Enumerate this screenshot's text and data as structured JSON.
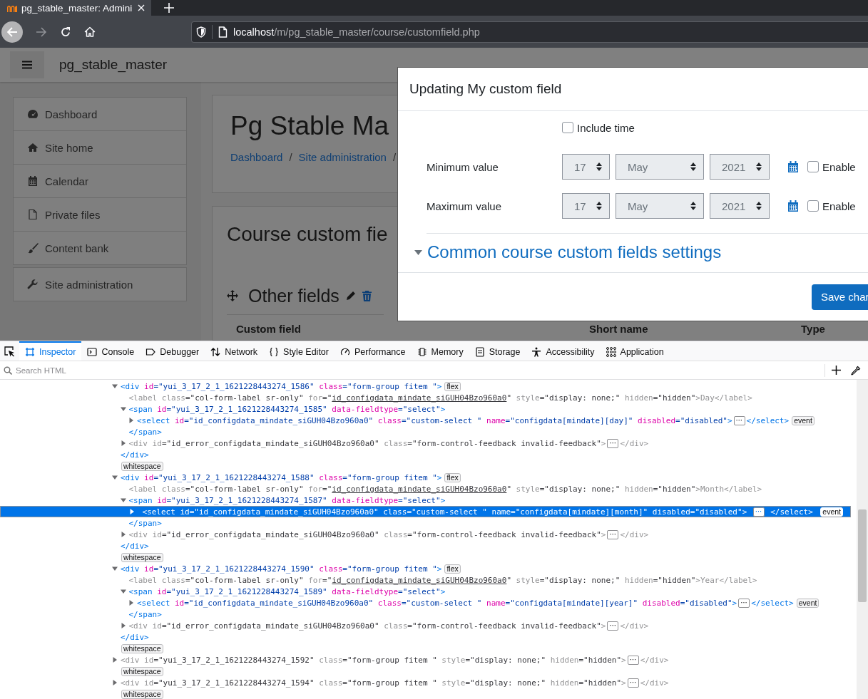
{
  "browser": {
    "tab": {
      "title": "pg_stable_master: Admini"
    },
    "url": {
      "host": "localhost",
      "path": "/m/pg_stable_master/course/customfield.php"
    }
  },
  "navbar": {
    "site_name": "pg_stable_master"
  },
  "sidebar": {
    "groups": [
      {
        "items": [
          {
            "label": "Dashboard"
          },
          {
            "label": "Site home"
          },
          {
            "label": "Calendar"
          },
          {
            "label": "Private files"
          },
          {
            "label": "Content bank"
          }
        ]
      },
      {
        "items": [
          {
            "label": "Site administration"
          }
        ]
      }
    ]
  },
  "header": {
    "title": "Pg Stable Ma",
    "breadcrumb": [
      {
        "label": "Dashboard",
        "separator": "/"
      },
      {
        "label": "Site administration",
        "separator": "/"
      }
    ]
  },
  "content": {
    "title": "Course custom fie",
    "category": "Other fields",
    "table": {
      "columns": [
        "Custom field",
        "Short name",
        "Type"
      ]
    }
  },
  "modal": {
    "title": "Updating My custom field",
    "include_time": {
      "label": "Include time",
      "checked": false
    },
    "rows": [
      {
        "label": "Minimum value",
        "day": "17",
        "month": "May",
        "year": "2021",
        "disabled": true,
        "enable": {
          "label": "Enable",
          "checked": false
        }
      },
      {
        "label": "Maximum value",
        "day": "17",
        "month": "May",
        "year": "2021",
        "disabled": true,
        "enable": {
          "label": "Enable",
          "checked": false
        }
      }
    ],
    "section": {
      "title": "Common course custom fields settings",
      "expanded": true
    },
    "save_button": "Save char"
  },
  "devtools": {
    "tabs": [
      {
        "label": "Inspector",
        "selected": true
      },
      {
        "label": "Console",
        "selected": false
      },
      {
        "label": "Debugger",
        "selected": false
      },
      {
        "label": "Network",
        "selected": false
      },
      {
        "label": "Style Editor",
        "selected": false
      },
      {
        "label": "Performance",
        "selected": false
      },
      {
        "label": "Memory",
        "selected": false
      },
      {
        "label": "Storage",
        "selected": false
      },
      {
        "label": "Accessibility",
        "selected": false
      },
      {
        "label": "Application",
        "selected": false
      }
    ],
    "search": {
      "placeholder": "Search HTML"
    },
    "tree": [
      {
        "kind": "element",
        "expanded": true,
        "dimmed": false,
        "selected": false,
        "badges": [
          "flex"
        ],
        "tag_open": [
          {
            "kind": "tag",
            "text": "<div"
          },
          {
            "kind": "attr",
            "text": " id"
          },
          {
            "kind": "value",
            "text": "=\"yui_3_17_2_1_1621228443274_1586\""
          },
          {
            "kind": "attr",
            "text": " class"
          },
          {
            "kind": "value",
            "text": "=\"form-group fitem \""
          },
          {
            "kind": "tag",
            "text": ">"
          }
        ],
        "tag_close": [
          {
            "kind": "tag",
            "text": "</div>"
          }
        ],
        "children": [
          {
            "kind": "element",
            "dimmed": true,
            "selected": false,
            "tag_open": [
              {
                "kind": "tag",
                "text": "<label"
              },
              {
                "kind": "attr",
                "text": " class"
              },
              {
                "kind": "value",
                "text": "=\"col-form-label sr-only\""
              },
              {
                "kind": "attr",
                "text": " for"
              },
              {
                "kind": "value",
                "text": "=\""
              },
              {
                "kind": "link",
                "text": "id_configdata_mindate_siGUH04Bzo960a0"
              },
              {
                "kind": "value",
                "text": "\""
              },
              {
                "kind": "attr",
                "text": " style"
              },
              {
                "kind": "value",
                "text": "=\"display: none;\""
              },
              {
                "kind": "attr",
                "text": " hidden"
              },
              {
                "kind": "value",
                "text": "=\"hidden\""
              },
              {
                "kind": "tag",
                "text": ">"
              },
              {
                "kind": "text",
                "text": "Day"
              },
              {
                "kind": "tag",
                "text": "</label>"
              }
            ]
          },
          {
            "kind": "element",
            "expanded": true,
            "dimmed": false,
            "selected": false,
            "tag_open": [
              {
                "kind": "tag",
                "text": "<span"
              },
              {
                "kind": "attr",
                "text": " id"
              },
              {
                "kind": "value",
                "text": "=\"yui_3_17_2_1_1621228443274_1585\""
              },
              {
                "kind": "attr",
                "text": " data-fieldtype"
              },
              {
                "kind": "value",
                "text": "=\"select\""
              },
              {
                "kind": "tag",
                "text": ">"
              }
            ],
            "tag_close": [
              {
                "kind": "tag",
                "text": "</span>"
              }
            ],
            "children": [
              {
                "kind": "element",
                "expanded": false,
                "dimmed": false,
                "selected": false,
                "inner": "⋯",
                "badges": [
                  "event"
                ],
                "tag_open": [
                  {
                    "kind": "tag",
                    "text": "<select"
                  },
                  {
                    "kind": "attr",
                    "text": " id"
                  },
                  {
                    "kind": "value",
                    "text": "=\"id_configdata_mindate_siGUH04Bzo960a0\""
                  },
                  {
                    "kind": "attr",
                    "text": " class"
                  },
                  {
                    "kind": "value",
                    "text": "=\"custom-select \""
                  },
                  {
                    "kind": "attr",
                    "text": " name"
                  },
                  {
                    "kind": "value",
                    "text": "=\"configdata[mindate][day]\""
                  },
                  {
                    "kind": "attr",
                    "text": " disabled"
                  },
                  {
                    "kind": "value",
                    "text": "=\"disabled\""
                  },
                  {
                    "kind": "tag",
                    "text": ">"
                  }
                ],
                "tag_close": [
                  {
                    "kind": "tag",
                    "text": "</select>"
                  }
                ]
              }
            ]
          },
          {
            "kind": "element",
            "expanded": false,
            "dimmed": true,
            "selected": false,
            "inner": "⋯",
            "tag_open": [
              {
                "kind": "tag",
                "text": "<div"
              },
              {
                "kind": "attr",
                "text": " id"
              },
              {
                "kind": "value",
                "text": "=\"id_error_configdata_mindate_siGUH04Bzo960a0\""
              },
              {
                "kind": "attr",
                "text": " class"
              },
              {
                "kind": "value",
                "text": "=\"form-control-feedback invalid-feedback\""
              },
              {
                "kind": "tag",
                "text": ">"
              }
            ],
            "tag_close": [
              {
                "kind": "tag",
                "text": "</div>"
              }
            ]
          }
        ]
      },
      {
        "kind": "whitespace",
        "label": "whitespace",
        "selected": false
      },
      {
        "kind": "element",
        "expanded": true,
        "dimmed": false,
        "selected": false,
        "badges": [
          "flex"
        ],
        "tag_open": [
          {
            "kind": "tag",
            "text": "<div"
          },
          {
            "kind": "attr",
            "text": " id"
          },
          {
            "kind": "value",
            "text": "=\"yui_3_17_2_1_1621228443274_1588\""
          },
          {
            "kind": "attr",
            "text": " class"
          },
          {
            "kind": "value",
            "text": "=\"form-group fitem \""
          },
          {
            "kind": "tag",
            "text": ">"
          }
        ],
        "tag_close": [
          {
            "kind": "tag",
            "text": "</div>"
          }
        ],
        "children": [
          {
            "kind": "element",
            "dimmed": true,
            "selected": false,
            "tag_open": [
              {
                "kind": "tag",
                "text": "<label"
              },
              {
                "kind": "attr",
                "text": " class"
              },
              {
                "kind": "value",
                "text": "=\"col-form-label sr-only\""
              },
              {
                "kind": "attr",
                "text": " for"
              },
              {
                "kind": "value",
                "text": "=\""
              },
              {
                "kind": "link",
                "text": "id_configdata_mindate_siGUH04Bzo960a0"
              },
              {
                "kind": "value",
                "text": "\""
              },
              {
                "kind": "attr",
                "text": " style"
              },
              {
                "kind": "value",
                "text": "=\"display: none;\""
              },
              {
                "kind": "attr",
                "text": " hidden"
              },
              {
                "kind": "value",
                "text": "=\"hidden\""
              },
              {
                "kind": "tag",
                "text": ">"
              },
              {
                "kind": "text",
                "text": "Month"
              },
              {
                "kind": "tag",
                "text": "</label>"
              }
            ]
          },
          {
            "kind": "element",
            "expanded": true,
            "dimmed": false,
            "selected": false,
            "tag_open": [
              {
                "kind": "tag",
                "text": "<span"
              },
              {
                "kind": "attr",
                "text": " id"
              },
              {
                "kind": "value",
                "text": "=\"yui_3_17_2_1_1621228443274_1587\""
              },
              {
                "kind": "attr",
                "text": " data-fieldtype"
              },
              {
                "kind": "value",
                "text": "=\"select\""
              },
              {
                "kind": "tag",
                "text": ">"
              }
            ],
            "tag_close": [
              {
                "kind": "tag",
                "text": "</span>"
              }
            ],
            "children": [
              {
                "kind": "element",
                "expanded": false,
                "dimmed": false,
                "selected": true,
                "inner": "⋯",
                "badges": [
                  "event"
                ],
                "tag_open": [
                  {
                    "kind": "tag",
                    "text": "<select"
                  },
                  {
                    "kind": "attr",
                    "text": " id"
                  },
                  {
                    "kind": "value",
                    "text": "=\"id_configdata_mindate_siGUH04Bzo960a0\""
                  },
                  {
                    "kind": "attr",
                    "text": " class"
                  },
                  {
                    "kind": "value",
                    "text": "=\"custom-select \""
                  },
                  {
                    "kind": "attr",
                    "text": " name"
                  },
                  {
                    "kind": "value",
                    "text": "=\"configdata[mindate][month]\""
                  },
                  {
                    "kind": "attr",
                    "text": " disabled"
                  },
                  {
                    "kind": "value",
                    "text": "=\"disabled\""
                  },
                  {
                    "kind": "tag",
                    "text": ">"
                  }
                ],
                "tag_close": [
                  {
                    "kind": "tag",
                    "text": "</select>"
                  }
                ]
              }
            ]
          },
          {
            "kind": "element",
            "expanded": false,
            "dimmed": true,
            "selected": false,
            "inner": "⋯",
            "tag_open": [
              {
                "kind": "tag",
                "text": "<div"
              },
              {
                "kind": "attr",
                "text": " id"
              },
              {
                "kind": "value",
                "text": "=\"id_error_configdata_mindate_siGUH04Bzo960a0\""
              },
              {
                "kind": "attr",
                "text": " class"
              },
              {
                "kind": "value",
                "text": "=\"form-control-feedback invalid-feedback\""
              },
              {
                "kind": "tag",
                "text": ">"
              }
            ],
            "tag_close": [
              {
                "kind": "tag",
                "text": "</div>"
              }
            ]
          }
        ]
      },
      {
        "kind": "whitespace",
        "label": "whitespace",
        "selected": false
      },
      {
        "kind": "element",
        "expanded": true,
        "dimmed": false,
        "selected": false,
        "badges": [
          "flex"
        ],
        "tag_open": [
          {
            "kind": "tag",
            "text": "<div"
          },
          {
            "kind": "attr",
            "text": " id"
          },
          {
            "kind": "value",
            "text": "=\"yui_3_17_2_1_1621228443274_1590\""
          },
          {
            "kind": "attr",
            "text": " class"
          },
          {
            "kind": "value",
            "text": "=\"form-group fitem \""
          },
          {
            "kind": "tag",
            "text": ">"
          }
        ],
        "tag_close": [
          {
            "kind": "tag",
            "text": "</div>"
          }
        ],
        "children": [
          {
            "kind": "element",
            "dimmed": true,
            "selected": false,
            "tag_open": [
              {
                "kind": "tag",
                "text": "<label"
              },
              {
                "kind": "attr",
                "text": " class"
              },
              {
                "kind": "value",
                "text": "=\"col-form-label sr-only\""
              },
              {
                "kind": "attr",
                "text": " for"
              },
              {
                "kind": "value",
                "text": "=\""
              },
              {
                "kind": "link",
                "text": "id_configdata_mindate_siGUH04Bzo960a0"
              },
              {
                "kind": "value",
                "text": "\""
              },
              {
                "kind": "attr",
                "text": " style"
              },
              {
                "kind": "value",
                "text": "=\"display: none;\""
              },
              {
                "kind": "attr",
                "text": " hidden"
              },
              {
                "kind": "value",
                "text": "=\"hidden\""
              },
              {
                "kind": "tag",
                "text": ">"
              },
              {
                "kind": "text",
                "text": "Year"
              },
              {
                "kind": "tag",
                "text": "</label>"
              }
            ]
          },
          {
            "kind": "element",
            "expanded": true,
            "dimmed": false,
            "selected": false,
            "tag_open": [
              {
                "kind": "tag",
                "text": "<span"
              },
              {
                "kind": "attr",
                "text": " id"
              },
              {
                "kind": "value",
                "text": "=\"yui_3_17_2_1_1621228443274_1589\""
              },
              {
                "kind": "attr",
                "text": " data-fieldtype"
              },
              {
                "kind": "value",
                "text": "=\"select\""
              },
              {
                "kind": "tag",
                "text": ">"
              }
            ],
            "tag_close": [
              {
                "kind": "tag",
                "text": "</span>"
              }
            ],
            "children": [
              {
                "kind": "element",
                "expanded": false,
                "dimmed": false,
                "selected": false,
                "inner": "⋯",
                "badges": [
                  "event"
                ],
                "tag_open": [
                  {
                    "kind": "tag",
                    "text": "<select"
                  },
                  {
                    "kind": "attr",
                    "text": " id"
                  },
                  {
                    "kind": "value",
                    "text": "=\"id_configdata_mindate_siGUH04Bzo960a0\""
                  },
                  {
                    "kind": "attr",
                    "text": " class"
                  },
                  {
                    "kind": "value",
                    "text": "=\"custom-select \""
                  },
                  {
                    "kind": "attr",
                    "text": " name"
                  },
                  {
                    "kind": "value",
                    "text": "=\"configdata[mindate][year]\""
                  },
                  {
                    "kind": "attr",
                    "text": " disabled"
                  },
                  {
                    "kind": "value",
                    "text": "=\"disabled\""
                  },
                  {
                    "kind": "tag",
                    "text": ">"
                  }
                ],
                "tag_close": [
                  {
                    "kind": "tag",
                    "text": "</select>"
                  }
                ]
              }
            ]
          },
          {
            "kind": "element",
            "expanded": false,
            "dimmed": true,
            "selected": false,
            "inner": "⋯",
            "tag_open": [
              {
                "kind": "tag",
                "text": "<div"
              },
              {
                "kind": "attr",
                "text": " id"
              },
              {
                "kind": "value",
                "text": "=\"id_error_configdata_mindate_siGUH04Bzo960a0\""
              },
              {
                "kind": "attr",
                "text": " class"
              },
              {
                "kind": "value",
                "text": "=\"form-control-feedback invalid-feedback\""
              },
              {
                "kind": "tag",
                "text": ">"
              }
            ],
            "tag_close": [
              {
                "kind": "tag",
                "text": "</div>"
              }
            ]
          }
        ]
      },
      {
        "kind": "whitespace",
        "label": "whitespace",
        "selected": false
      },
      {
        "kind": "element",
        "expanded": false,
        "dimmed": true,
        "selected": false,
        "inner": "⋯",
        "tag_open": [
          {
            "kind": "tag",
            "text": "<div"
          },
          {
            "kind": "attr",
            "text": " id"
          },
          {
            "kind": "value",
            "text": "=\"yui_3_17_2_1_1621228443274_1592\""
          },
          {
            "kind": "attr",
            "text": " class"
          },
          {
            "kind": "value",
            "text": "=\"form-group fitem \""
          },
          {
            "kind": "attr",
            "text": " style"
          },
          {
            "kind": "value",
            "text": "=\"display: none;\""
          },
          {
            "kind": "attr",
            "text": " hidden"
          },
          {
            "kind": "value",
            "text": "=\"hidden\""
          },
          {
            "kind": "tag",
            "text": ">"
          }
        ],
        "tag_close": [
          {
            "kind": "tag",
            "text": "</div>"
          }
        ]
      },
      {
        "kind": "whitespace",
        "label": "whitespace",
        "selected": false
      },
      {
        "kind": "element",
        "expanded": false,
        "dimmed": true,
        "selected": false,
        "inner": "⋯",
        "tag_open": [
          {
            "kind": "tag",
            "text": "<div"
          },
          {
            "kind": "attr",
            "text": " id"
          },
          {
            "kind": "value",
            "text": "=\"yui_3_17_2_1_1621228443274_1594\""
          },
          {
            "kind": "attr",
            "text": " class"
          },
          {
            "kind": "value",
            "text": "=\"form-group fitem \""
          },
          {
            "kind": "attr",
            "text": " style"
          },
          {
            "kind": "value",
            "text": "=\"display: none;\""
          },
          {
            "kind": "attr",
            "text": " hidden"
          },
          {
            "kind": "value",
            "text": "=\"hidden\""
          },
          {
            "kind": "tag",
            "text": ">"
          }
        ],
        "tag_close": [
          {
            "kind": "tag",
            "text": "</div>"
          }
        ]
      },
      {
        "kind": "whitespace",
        "label": "whitespace",
        "selected": false
      }
    ]
  }
}
